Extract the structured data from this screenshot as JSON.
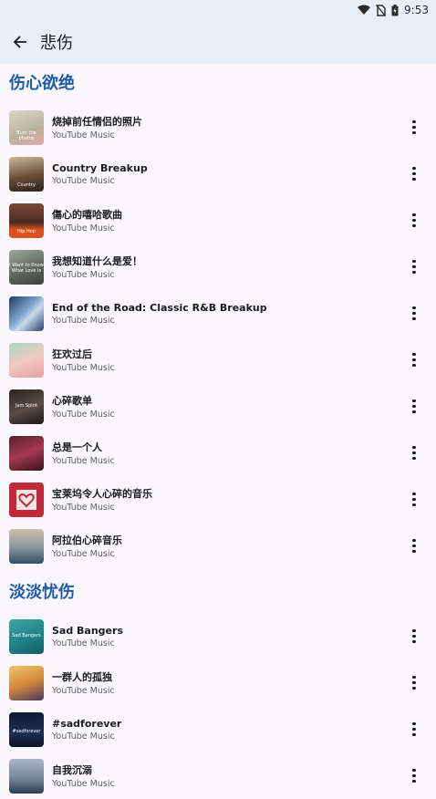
{
  "status": {
    "time": "9:53"
  },
  "header": {
    "title": "悲伤"
  },
  "sections": [
    {
      "title": "伤心欲绝",
      "items": [
        {
          "title": "烧掉前任情侣的照片",
          "subtitle": "YouTube Music",
          "caption": "Burn the photos"
        },
        {
          "title": "Country Breakup",
          "subtitle": "YouTube Music",
          "caption": "Country"
        },
        {
          "title": "傷心的嘻哈歌曲",
          "subtitle": "YouTube Music",
          "caption": "Hip Hop"
        },
        {
          "title": "我想知道什么是爱！",
          "subtitle": "YouTube Music",
          "caption": "I Want to Know What Love Is"
        },
        {
          "title": "End of the Road: Classic R&B Breakup",
          "subtitle": "YouTube Music",
          "caption": ""
        },
        {
          "title": "狂欢过后",
          "subtitle": "YouTube Music",
          "caption": ""
        },
        {
          "title": "心碎歌单",
          "subtitle": "YouTube Music",
          "caption": "Jam Spirit"
        },
        {
          "title": "总是一个人",
          "subtitle": "YouTube Music",
          "caption": ""
        },
        {
          "title": "宝莱坞令人心碎的音乐",
          "subtitle": "YouTube Music",
          "caption": ""
        },
        {
          "title": "阿拉伯心碎音乐",
          "subtitle": "YouTube Music",
          "caption": ""
        }
      ]
    },
    {
      "title": "淡淡忧伤",
      "items": [
        {
          "title": "Sad Bangers",
          "subtitle": "YouTube Music",
          "caption": "Sad Bangers"
        },
        {
          "title": "一群人的孤独",
          "subtitle": "YouTube Music",
          "caption": ""
        },
        {
          "title": "#sadforever",
          "subtitle": "YouTube Music",
          "caption": "#sadforever"
        },
        {
          "title": "自我沉溺",
          "subtitle": "YouTube Music",
          "caption": ""
        }
      ]
    }
  ],
  "colors": {
    "accent": "#1f5ca8",
    "app_bar": "#e9eef9",
    "background": "#fbf8fd"
  }
}
